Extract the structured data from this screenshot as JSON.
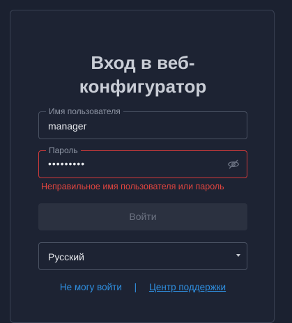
{
  "login": {
    "title_line1": "Вход в веб-",
    "title_line2": "конфигуратор",
    "username": {
      "label": "Имя пользователя",
      "value": "manager"
    },
    "password": {
      "label": "Пароль",
      "masked_value": "•••••••••",
      "toggle_icon": "eye-slash-icon"
    },
    "error": "Неправильное имя пользователя или пароль",
    "submit_label": "Войти",
    "language": {
      "selected": "Русский",
      "icon": "chevron-down-icon"
    },
    "links": {
      "cant_login": "Не могу войти",
      "separator": "|",
      "support": "Центр поддержки"
    },
    "colors": {
      "background": "#1b2130",
      "error": "#e0453f",
      "link": "#2f8fe0"
    }
  }
}
